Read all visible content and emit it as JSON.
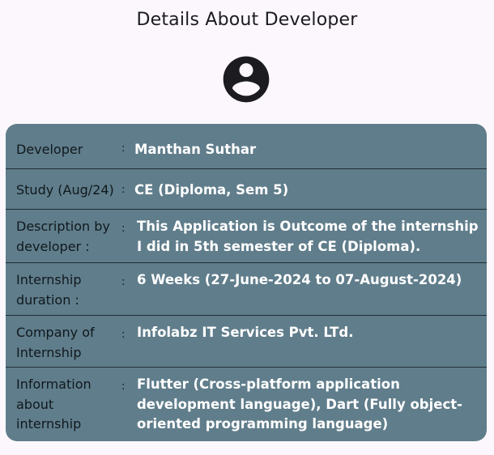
{
  "header": {
    "title": "Details About Developer"
  },
  "avatar": {
    "icon": "account-circle-icon",
    "color": "#1c1b1f"
  },
  "colors": {
    "card_bg": "#607d8b",
    "label_text": "#10191d",
    "value_text": "#ffffff",
    "divider": "#1f2f36"
  },
  "rows": [
    {
      "label": "Developer",
      "separator": ":",
      "value": "Manthan Suthar"
    },
    {
      "label": "Study (Aug/24)",
      "separator": ":",
      "value": "CE (Diploma, Sem 5)"
    },
    {
      "label": "Description by developer :",
      "separator": ":",
      "value": "This Application is Outcome of the internship I did in 5th semester of CE (Diploma)."
    },
    {
      "label": "Internship duration :",
      "separator": ":",
      "value": "6 Weeks (27-June-2024 to 07-August-2024)"
    },
    {
      "label": "Company of Internship",
      "separator": ":",
      "value": "Infolabz IT Services Pvt. LTd."
    },
    {
      "label": "Information about internship",
      "separator": ":",
      "value": "Flutter (Cross-platform application development language), Dart (Fully object-oriented programming language)"
    }
  ]
}
